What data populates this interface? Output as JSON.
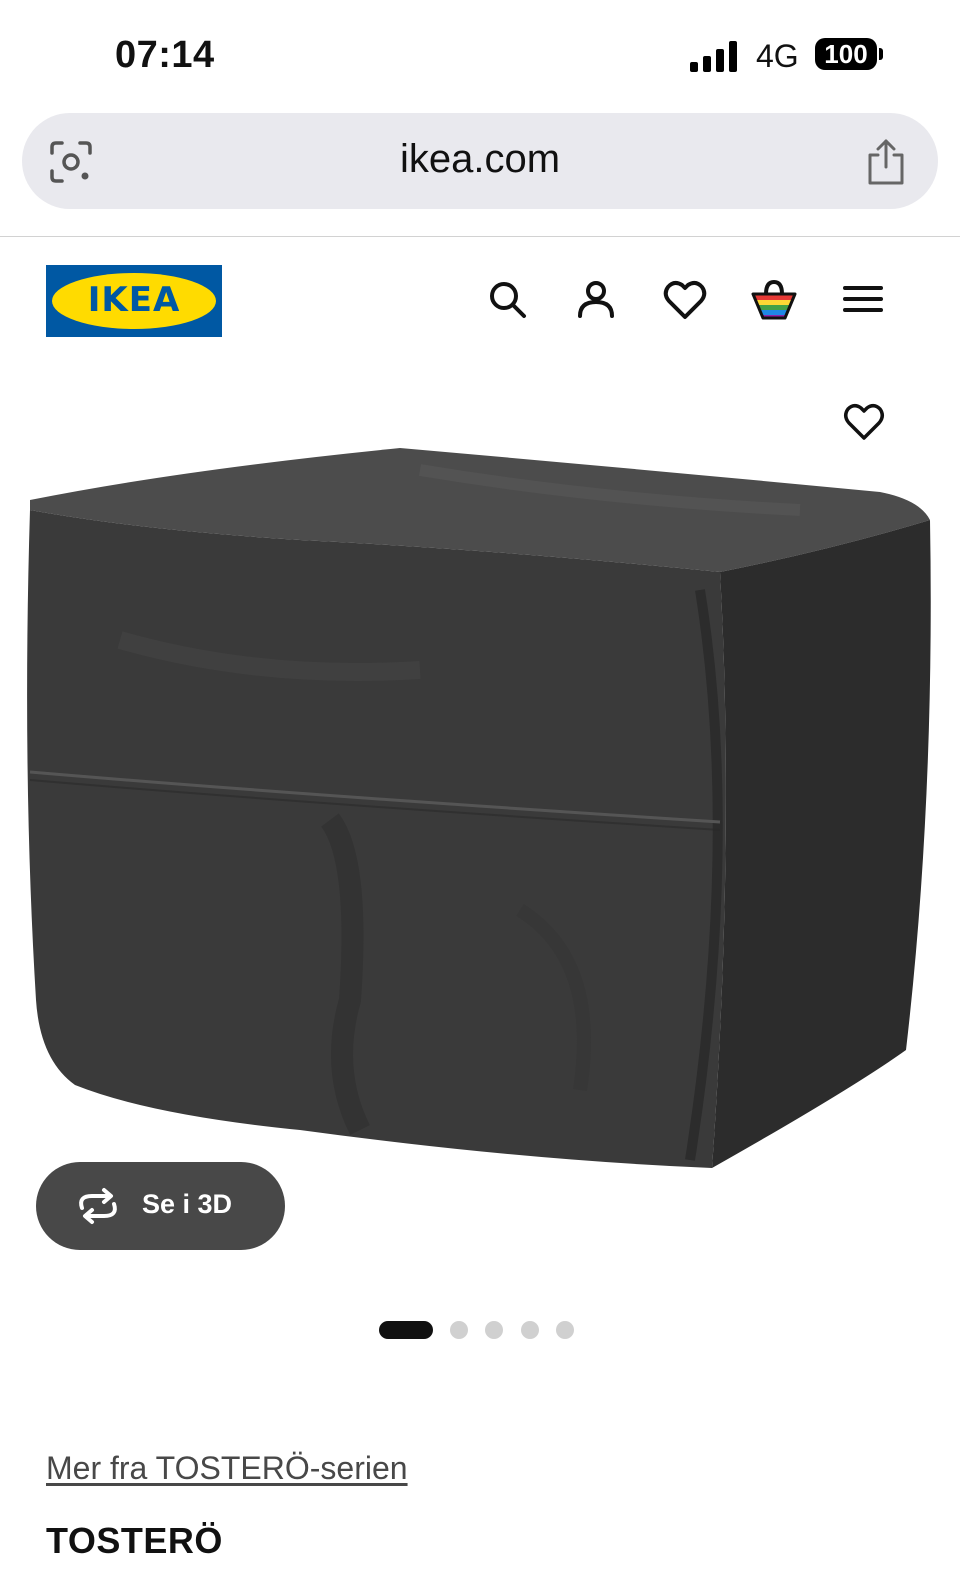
{
  "status_bar": {
    "time": "07:14",
    "network": "4G",
    "battery": "100",
    "signal_icon": "cellular-signal-icon"
  },
  "browser": {
    "url": "ikea.com",
    "left_icon": "lens-icon",
    "right_icon": "share-icon"
  },
  "header": {
    "logo_text": "IKEA",
    "icons": [
      "search-icon",
      "account-icon",
      "wishlist-heart-icon",
      "shopping-bag-icon",
      "hamburger-menu-icon"
    ],
    "colors": {
      "logo_blue": "#0058a3",
      "logo_yellow": "#ffdb00"
    }
  },
  "gallery": {
    "view_3d_label": "Se i 3D",
    "view_3d_icon": "rotate-3d-icon",
    "favorite_icon": "heart-outline-icon",
    "total_images": 5,
    "active_index": 0,
    "image_description_icon": "product-cover-image"
  },
  "product": {
    "series_link": "Mer fra TOSTERÖ-serien",
    "name": "TOSTERÖ"
  }
}
